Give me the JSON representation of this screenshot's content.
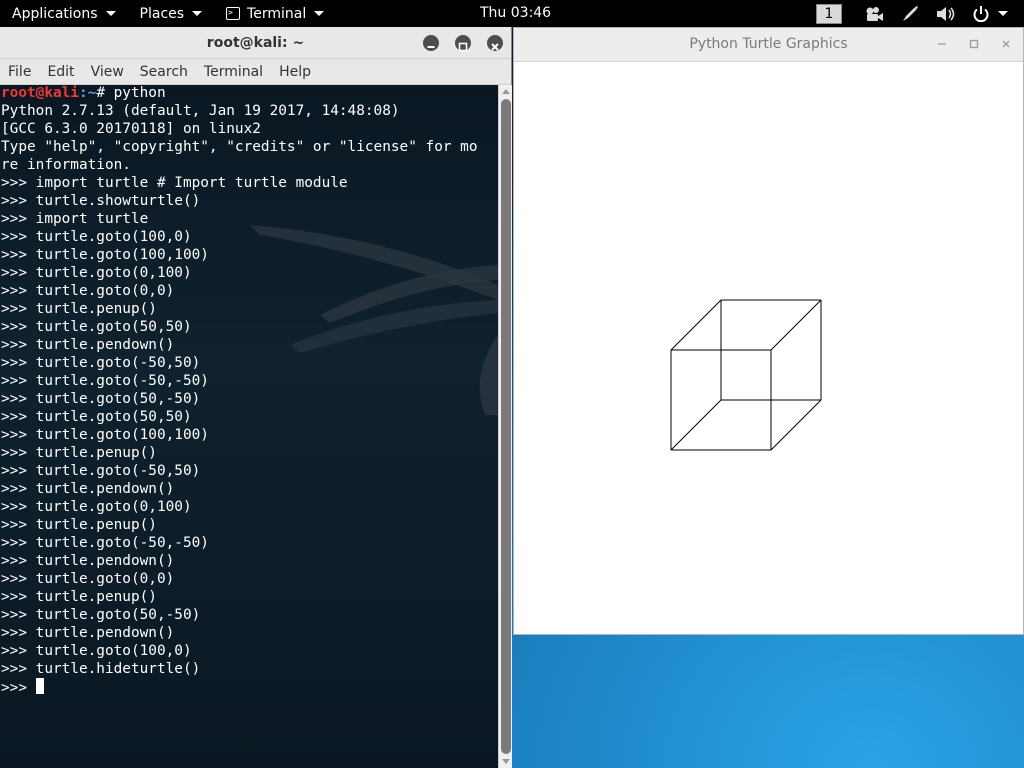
{
  "topbar": {
    "applications": "Applications",
    "places": "Places",
    "terminal": "Terminal",
    "clock": "Thu 03:46",
    "workspace": "1"
  },
  "terminal_window": {
    "title": "root@kali: ~",
    "menu": [
      "File",
      "Edit",
      "View",
      "Search",
      "Terminal",
      "Help"
    ],
    "prompt_user": "root@kali",
    "prompt_path": ":~",
    "prompt_cmd": "# python",
    "lines": [
      "Python 2.7.13 (default, Jan 19 2017, 14:48:08)",
      "[GCC 6.3.0 20170118] on linux2",
      "Type \"help\", \"copyright\", \"credits\" or \"license\" for mo",
      "re information.",
      ">>> import turtle # Import turtle module",
      ">>> turtle.showturtle()",
      ">>> import turtle",
      ">>> turtle.goto(100,0)",
      ">>> turtle.goto(100,100)",
      ">>> turtle.goto(0,100)",
      ">>> turtle.goto(0,0)",
      ">>> turtle.penup()",
      ">>> turtle.goto(50,50)",
      ">>> turtle.pendown()",
      ">>> turtle.goto(-50,50)",
      ">>> turtle.goto(-50,-50)",
      ">>> turtle.goto(50,-50)",
      ">>> turtle.goto(50,50)",
      ">>> turtle.goto(100,100)",
      ">>> turtle.penup()",
      ">>> turtle.goto(-50,50)",
      ">>> turtle.pendown()",
      ">>> turtle.goto(0,100)",
      ">>> turtle.penup()",
      ">>> turtle.goto(-50,-50)",
      ">>> turtle.pendown()",
      ">>> turtle.goto(0,0)",
      ">>> turtle.penup()",
      ">>> turtle.goto(50,-50)",
      ">>> turtle.pendown()",
      ">>> turtle.goto(100,0)",
      ">>> turtle.hideturtle()"
    ],
    "final_prompt": ">>> "
  },
  "turtle_window": {
    "title": "Python Turtle Graphics",
    "drawing": {
      "pen_color": "#000000",
      "segments": [
        [
          [
            0,
            0
          ],
          [
            100,
            0
          ]
        ],
        [
          [
            100,
            0
          ],
          [
            100,
            100
          ]
        ],
        [
          [
            100,
            100
          ],
          [
            0,
            100
          ]
        ],
        [
          [
            0,
            100
          ],
          [
            0,
            0
          ]
        ],
        [
          [
            50,
            50
          ],
          [
            -50,
            50
          ]
        ],
        [
          [
            -50,
            50
          ],
          [
            -50,
            -50
          ]
        ],
        [
          [
            -50,
            -50
          ],
          [
            50,
            -50
          ]
        ],
        [
          [
            50,
            -50
          ],
          [
            50,
            50
          ]
        ],
        [
          [
            50,
            50
          ],
          [
            100,
            100
          ]
        ],
        [
          [
            -50,
            50
          ],
          [
            0,
            100
          ]
        ],
        [
          [
            -50,
            -50
          ],
          [
            0,
            0
          ]
        ],
        [
          [
            50,
            -50
          ],
          [
            100,
            0
          ]
        ]
      ]
    }
  },
  "colors": {
    "prompt_user": "#ee3a3a",
    "prompt_path": "#6f9bd8"
  }
}
